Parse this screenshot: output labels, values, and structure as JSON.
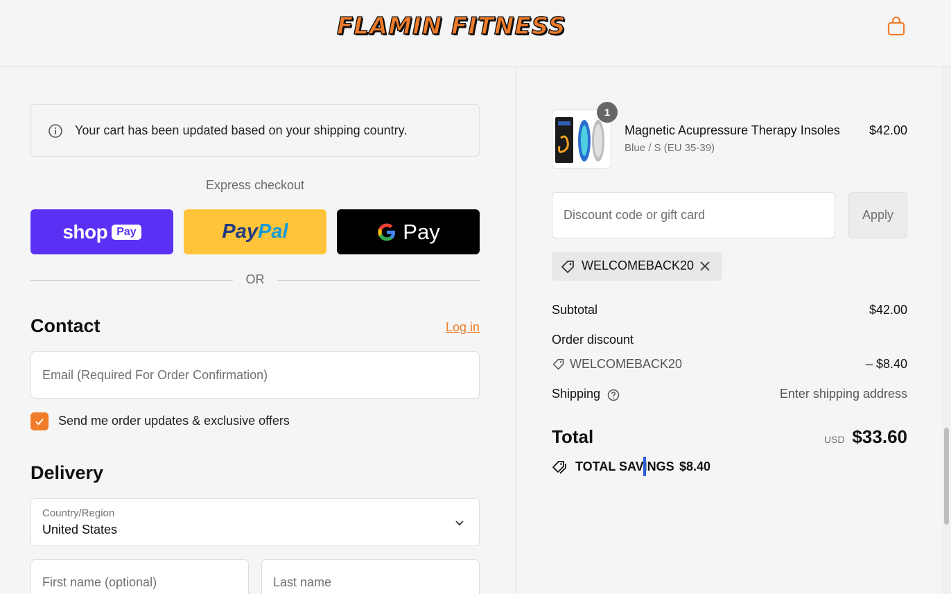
{
  "header": {
    "logo_text": "FLAMIN FITNESS",
    "cart_icon": "shopping-bag-icon",
    "brand_color": "#f07c2a"
  },
  "notice": {
    "icon": "info-icon",
    "text": "Your cart has been updated based on your shipping country."
  },
  "express": {
    "label": "Express checkout",
    "shop_word": "shop",
    "shop_pay_badge": "Pay",
    "paypal_part1": "Pay",
    "paypal_part2": "Pal",
    "gpay_word": "Pay",
    "or_text": "OR",
    "colors": {
      "shop": "#5a31f4",
      "paypal": "#ffc439",
      "gpay": "#000000"
    }
  },
  "contact": {
    "heading": "Contact",
    "login_link": "Log in",
    "email_placeholder": "Email (Required For Order Confirmation)",
    "email_value": "",
    "marketing_checked": true,
    "marketing_label": "Send me order updates & exclusive offers"
  },
  "delivery": {
    "heading": "Delivery",
    "country_label": "Country/Region",
    "country_value": "United States",
    "first_name_placeholder": "First name (optional)",
    "last_name_placeholder": "Last name"
  },
  "order": {
    "product": {
      "name": "Magnetic Acupressure Therapy Insoles",
      "variant": "Blue / S (EU 35-39)",
      "price": "$42.00",
      "quantity": "1"
    },
    "discount_placeholder": "Discount code or gift card",
    "apply_label": "Apply",
    "applied_code": "WELCOMEBACK20",
    "subtotal_label": "Subtotal",
    "subtotal_value": "$42.00",
    "order_discount_label": "Order discount",
    "discount_code": "WELCOMEBACK20",
    "discount_value": "– $8.40",
    "shipping_label": "Shipping",
    "shipping_value": "Enter shipping address",
    "total_label": "Total",
    "currency": "USD",
    "total_value": "$33.60",
    "savings_label": "TOTAL SAVINGS",
    "savings_value": "$8.40"
  }
}
